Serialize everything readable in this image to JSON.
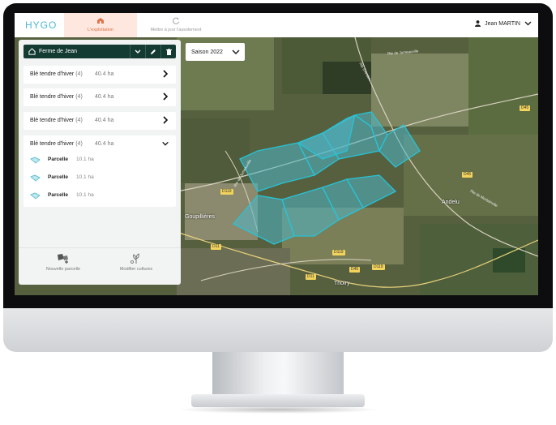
{
  "app": {
    "logo": "HYGO",
    "tabs": [
      {
        "label": "L'exploitation",
        "active": true,
        "icon": "farm-icon"
      },
      {
        "label": "Mettre à jour l'assolement",
        "active": false,
        "icon": "refresh-icon"
      }
    ],
    "user": {
      "name": "Jean MARTIN",
      "icon": "user-icon"
    }
  },
  "panel": {
    "farm": {
      "name": "Ferme de Jean"
    },
    "crops": [
      {
        "name": "Blé tendre d'hiver",
        "count": "(4)",
        "area": "40.4 ha",
        "expanded": false
      },
      {
        "name": "Blé tendre d'hiver",
        "count": "(4)",
        "area": "40.4 ha",
        "expanded": false
      },
      {
        "name": "Blé tendre d'hiver",
        "count": "(4)",
        "area": "40.4 ha",
        "expanded": false
      },
      {
        "name": "Blé tendre d'hiver",
        "count": "(4)",
        "area": "40.4 ha",
        "expanded": true,
        "plots": [
          {
            "name": "Parcelle",
            "area": "10.1 ha"
          },
          {
            "name": "Parcelle",
            "area": "10.1 ha"
          },
          {
            "name": "Parcelle",
            "area": "10.1 ha"
          }
        ]
      }
    ],
    "actions": {
      "new_plot": "Nouvelle parcelle",
      "edit_crops": "Modifier cultures"
    }
  },
  "map": {
    "season": "Saison 2022",
    "towns": [
      "Goupillières",
      "Andelu",
      "Thoiry"
    ],
    "road_labels": [
      "D119",
      "D11",
      "D119",
      "D45",
      "D119",
      "D45",
      "D45",
      "D11"
    ],
    "road_names": [
      "Rte de Jumeauville",
      "Rte d'Andelu",
      "Rte de Jumeauville",
      "Rte de Montainville"
    ],
    "colors": {
      "field_fill": "#4fb6c8",
      "field_stroke": "#27c3d6",
      "accent": "#e0734a",
      "panel_header": "#133b32"
    }
  }
}
